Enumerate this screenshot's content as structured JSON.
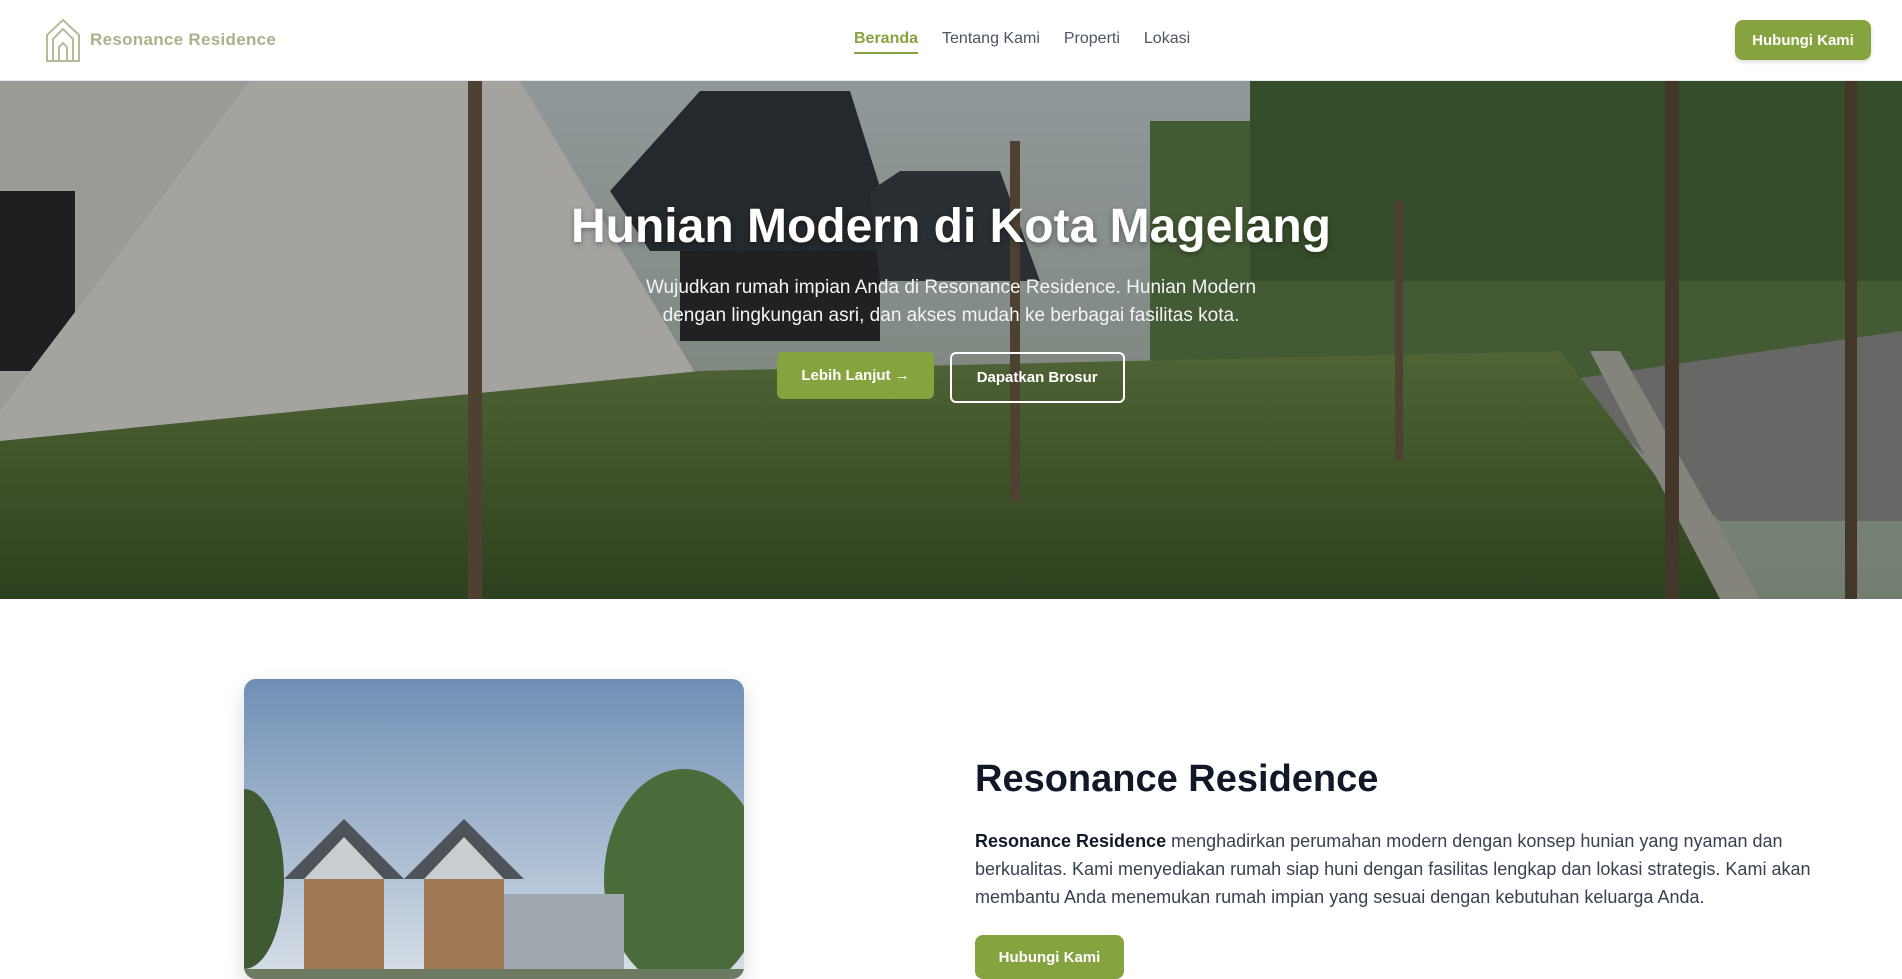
{
  "brand": {
    "name": "Resonance Residence",
    "logo_icon": "house-outline-logo-icon",
    "color": "#a8b38a"
  },
  "nav": {
    "items": [
      {
        "label": "Beranda",
        "active": true
      },
      {
        "label": "Tentang Kami",
        "active": false
      },
      {
        "label": "Properti",
        "active": false
      },
      {
        "label": "Lokasi",
        "active": false
      }
    ],
    "cta_label": "Hubungi Kami"
  },
  "hero": {
    "title": "Hunian Modern di Kota Magelang",
    "subtitle": "Wujudkan rumah impian Anda di Resonance Residence. Hunian Modern dengan lingkungan asri, dan akses mudah ke berbagai fasilitas kota.",
    "primary_label": "Lebih Lanjut →",
    "secondary_label": "Dapatkan Brosur"
  },
  "about": {
    "title": "Resonance Residence",
    "body_strong": "Resonance Residence",
    "body_rest": " menghadirkan perumahan modern dengan konsep hunian yang nyaman dan berkualitas. Kami menyediakan rumah siap huni dengan fasilitas lengkap dan lokasi strategis. Kami akan membantu Anda menemukan rumah impian yang sesuai dengan kebutuhan keluarga Anda.",
    "button_label": "Hubungi Kami"
  },
  "colors": {
    "accent": "#86a33f",
    "text_dark": "#111827",
    "text_body": "#374151"
  }
}
